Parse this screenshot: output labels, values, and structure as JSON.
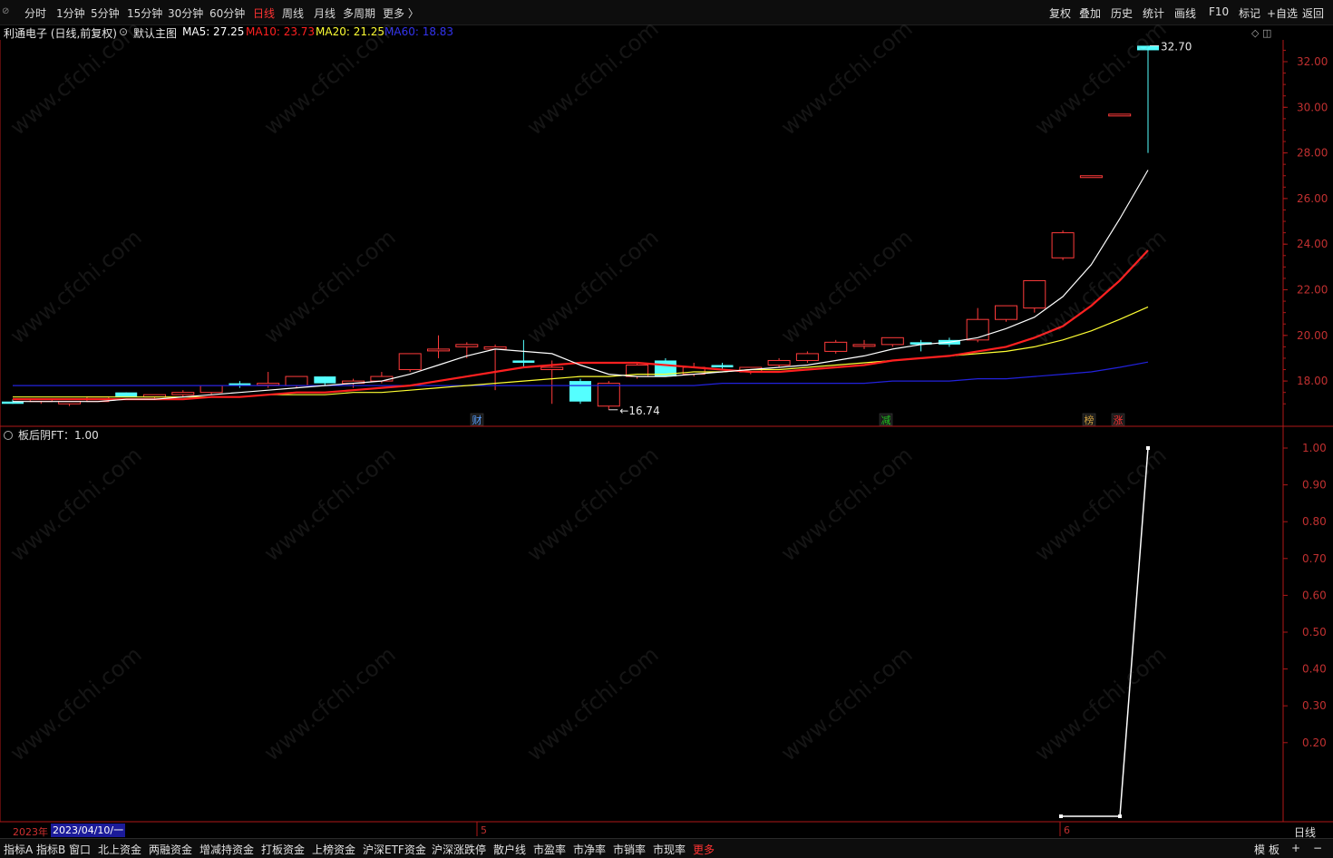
{
  "toolbar": {
    "periods": [
      {
        "label": "分时",
        "active": false
      },
      {
        "label": "1分钟",
        "active": false
      },
      {
        "label": "5分钟",
        "active": false
      },
      {
        "label": "15分钟",
        "active": false
      },
      {
        "label": "30分钟",
        "active": false
      },
      {
        "label": "60分钟",
        "active": false
      },
      {
        "label": "日线",
        "active": true
      },
      {
        "label": "周线",
        "active": false
      },
      {
        "label": "月线",
        "active": false
      },
      {
        "label": "多周期",
        "active": false
      },
      {
        "label": "更多 〉",
        "active": false
      }
    ],
    "right_tools": [
      "复权",
      "叠加",
      "历史",
      "统计",
      "画线",
      "F10",
      "标记",
      "+自选",
      "返回"
    ]
  },
  "info": {
    "stock": "利通电子 (日线,前复权)",
    "template": "默认主图",
    "ma5": "MA5: 27.25",
    "ma10": "MA10: 23.73",
    "ma20": "MA20: 21.25",
    "ma60": "MA60: 18.83"
  },
  "indicator": {
    "label": "板后阴FT：1.00"
  },
  "colors": {
    "up": "#ff3b3b",
    "down": "#54ffff",
    "ma5": "#ffffff",
    "ma10": "#ff2020",
    "ma20": "#ffff33",
    "ma60": "#2222dd",
    "axis": "#b01818"
  },
  "price_axis": [
    "32.00",
    "30.00",
    "28.00",
    "26.00",
    "24.00",
    "22.00",
    "20.00",
    "18.00"
  ],
  "indicator_axis": [
    "1.00",
    "0.90",
    "0.80",
    "0.70",
    "0.60",
    "0.50",
    "0.40",
    "0.30",
    "0.20"
  ],
  "annotations": {
    "high": "32.70",
    "low": "16.74",
    "markers": [
      {
        "text": "财",
        "color": "#5aa0ff"
      },
      {
        "text": "减",
        "color": "#20c020"
      },
      {
        "text": "榜",
        "color": "#d0a040"
      },
      {
        "text": "涨",
        "color": "#ff3333"
      }
    ]
  },
  "xaxis": {
    "year": "2023年",
    "cursor_date": "2023/04/10/一",
    "month_labels": [
      "5",
      "6"
    ],
    "period": "日线"
  },
  "bottom_tabs": [
    "指标A",
    "指标B",
    "窗口",
    "北上资金",
    "两融资金",
    "增减持资金",
    "打板资金",
    "上榜资金",
    "沪深ETF资金",
    "沪深涨跌停",
    "散户线",
    "市盈率",
    "市净率",
    "市销率",
    "市现率",
    "更多"
  ],
  "bottom_right": [
    "模",
    "板",
    "+",
    "−"
  ],
  "watermark": "www.cfchi.com",
  "chart_data": {
    "type": "candlestick",
    "candles": [
      {
        "o": 17.1,
        "h": 17.2,
        "l": 17.0,
        "c": 17.0
      },
      {
        "o": 17.1,
        "h": 17.2,
        "l": 17.0,
        "c": 17.2
      },
      {
        "o": 17.0,
        "h": 17.1,
        "l": 16.9,
        "c": 17.1
      },
      {
        "o": 17.1,
        "h": 17.3,
        "l": 17.1,
        "c": 17.3
      },
      {
        "o": 17.5,
        "h": 17.5,
        "l": 17.3,
        "c": 17.3
      },
      {
        "o": 17.3,
        "h": 17.4,
        "l": 17.2,
        "c": 17.4
      },
      {
        "o": 17.4,
        "h": 17.6,
        "l": 17.3,
        "c": 17.5
      },
      {
        "o": 17.5,
        "h": 17.8,
        "l": 17.4,
        "c": 17.8
      },
      {
        "o": 17.9,
        "h": 18.0,
        "l": 17.7,
        "c": 17.8
      },
      {
        "o": 17.9,
        "h": 18.4,
        "l": 17.7,
        "c": 17.9
      },
      {
        "o": 17.8,
        "h": 18.2,
        "l": 17.7,
        "c": 18.2
      },
      {
        "o": 18.2,
        "h": 18.2,
        "l": 17.8,
        "c": 17.9
      },
      {
        "o": 17.9,
        "h": 18.1,
        "l": 17.7,
        "c": 18.0
      },
      {
        "o": 18.0,
        "h": 18.4,
        "l": 17.9,
        "c": 18.2
      },
      {
        "o": 18.5,
        "h": 19.2,
        "l": 18.4,
        "c": 19.2
      },
      {
        "o": 19.4,
        "h": 20.0,
        "l": 19.0,
        "c": 19.4
      },
      {
        "o": 19.5,
        "h": 19.7,
        "l": 19.0,
        "c": 19.6
      },
      {
        "o": 19.4,
        "h": 19.6,
        "l": 17.6,
        "c": 19.5
      },
      {
        "o": 18.9,
        "h": 19.8,
        "l": 18.6,
        "c": 18.8
      },
      {
        "o": 18.5,
        "h": 18.9,
        "l": 17.0,
        "c": 18.6
      },
      {
        "o": 18.0,
        "h": 18.1,
        "l": 17.0,
        "c": 17.1
      },
      {
        "o": 16.9,
        "h": 18.0,
        "l": 16.74,
        "c": 17.9
      },
      {
        "o": 18.2,
        "h": 18.8,
        "l": 18.1,
        "c": 18.7
      },
      {
        "o": 18.9,
        "h": 19.0,
        "l": 18.2,
        "c": 18.2
      },
      {
        "o": 18.3,
        "h": 18.8,
        "l": 18.2,
        "c": 18.6
      },
      {
        "o": 18.7,
        "h": 18.8,
        "l": 18.5,
        "c": 18.6
      },
      {
        "o": 18.4,
        "h": 18.6,
        "l": 18.3,
        "c": 18.6
      },
      {
        "o": 18.7,
        "h": 19.0,
        "l": 18.6,
        "c": 18.9
      },
      {
        "o": 18.9,
        "h": 19.3,
        "l": 18.8,
        "c": 19.2
      },
      {
        "o": 19.3,
        "h": 19.8,
        "l": 19.2,
        "c": 19.7
      },
      {
        "o": 19.6,
        "h": 19.8,
        "l": 19.4,
        "c": 19.6
      },
      {
        "o": 19.6,
        "h": 19.9,
        "l": 19.5,
        "c": 19.9
      },
      {
        "o": 19.7,
        "h": 19.8,
        "l": 19.3,
        "c": 19.6
      },
      {
        "o": 19.8,
        "h": 19.9,
        "l": 19.5,
        "c": 19.6
      },
      {
        "o": 19.8,
        "h": 21.2,
        "l": 19.7,
        "c": 20.7
      },
      {
        "o": 20.7,
        "h": 21.3,
        "l": 20.6,
        "c": 21.3
      },
      {
        "o": 21.2,
        "h": 22.4,
        "l": 21.0,
        "c": 22.4
      },
      {
        "o": 23.4,
        "h": 24.6,
        "l": 23.3,
        "c": 24.5
      },
      {
        "o": 27.0,
        "h": 27.0,
        "l": 27.0,
        "c": 27.0
      },
      {
        "o": 29.7,
        "h": 29.7,
        "l": 29.7,
        "c": 29.7
      },
      {
        "o": 32.7,
        "h": 32.7,
        "l": 28.0,
        "c": 32.5
      }
    ],
    "ma5": [
      17.1,
      17.1,
      17.1,
      17.1,
      17.2,
      17.2,
      17.3,
      17.4,
      17.5,
      17.6,
      17.7,
      17.8,
      17.9,
      18.0,
      18.3,
      18.7,
      19.1,
      19.4,
      19.3,
      19.2,
      18.7,
      18.3,
      18.2,
      18.2,
      18.3,
      18.4,
      18.5,
      18.6,
      18.7,
      18.9,
      19.1,
      19.4,
      19.6,
      19.7,
      19.9,
      20.3,
      20.8,
      21.7,
      23.1,
      25.1,
      27.25
    ],
    "ma10": [
      17.2,
      17.2,
      17.2,
      17.2,
      17.2,
      17.2,
      17.2,
      17.3,
      17.3,
      17.4,
      17.5,
      17.5,
      17.6,
      17.7,
      17.8,
      18.0,
      18.2,
      18.4,
      18.6,
      18.7,
      18.8,
      18.8,
      18.8,
      18.7,
      18.6,
      18.5,
      18.4,
      18.4,
      18.5,
      18.6,
      18.7,
      18.9,
      19.0,
      19.1,
      19.3,
      19.5,
      19.9,
      20.4,
      21.3,
      22.4,
      23.73
    ],
    "ma20": [
      17.3,
      17.3,
      17.3,
      17.3,
      17.3,
      17.3,
      17.3,
      17.3,
      17.3,
      17.4,
      17.4,
      17.4,
      17.5,
      17.5,
      17.6,
      17.7,
      17.8,
      17.9,
      18.0,
      18.1,
      18.2,
      18.2,
      18.3,
      18.3,
      18.4,
      18.4,
      18.5,
      18.5,
      18.6,
      18.7,
      18.8,
      18.9,
      19.0,
      19.1,
      19.2,
      19.3,
      19.5,
      19.8,
      20.2,
      20.7,
      21.25
    ],
    "ma60": [
      17.8,
      17.8,
      17.8,
      17.8,
      17.8,
      17.8,
      17.8,
      17.8,
      17.8,
      17.8,
      17.8,
      17.8,
      17.8,
      17.8,
      17.8,
      17.8,
      17.8,
      17.8,
      17.8,
      17.8,
      17.8,
      17.8,
      17.8,
      17.8,
      17.8,
      17.9,
      17.9,
      17.9,
      17.9,
      17.9,
      17.9,
      18.0,
      18.0,
      18.0,
      18.1,
      18.1,
      18.2,
      18.3,
      18.4,
      18.6,
      18.83
    ],
    "indicator": [
      0,
      0,
      1
    ],
    "ylim": [
      16.0,
      33.5
    ],
    "indicator_ylim": [
      0,
      1.0
    ]
  }
}
